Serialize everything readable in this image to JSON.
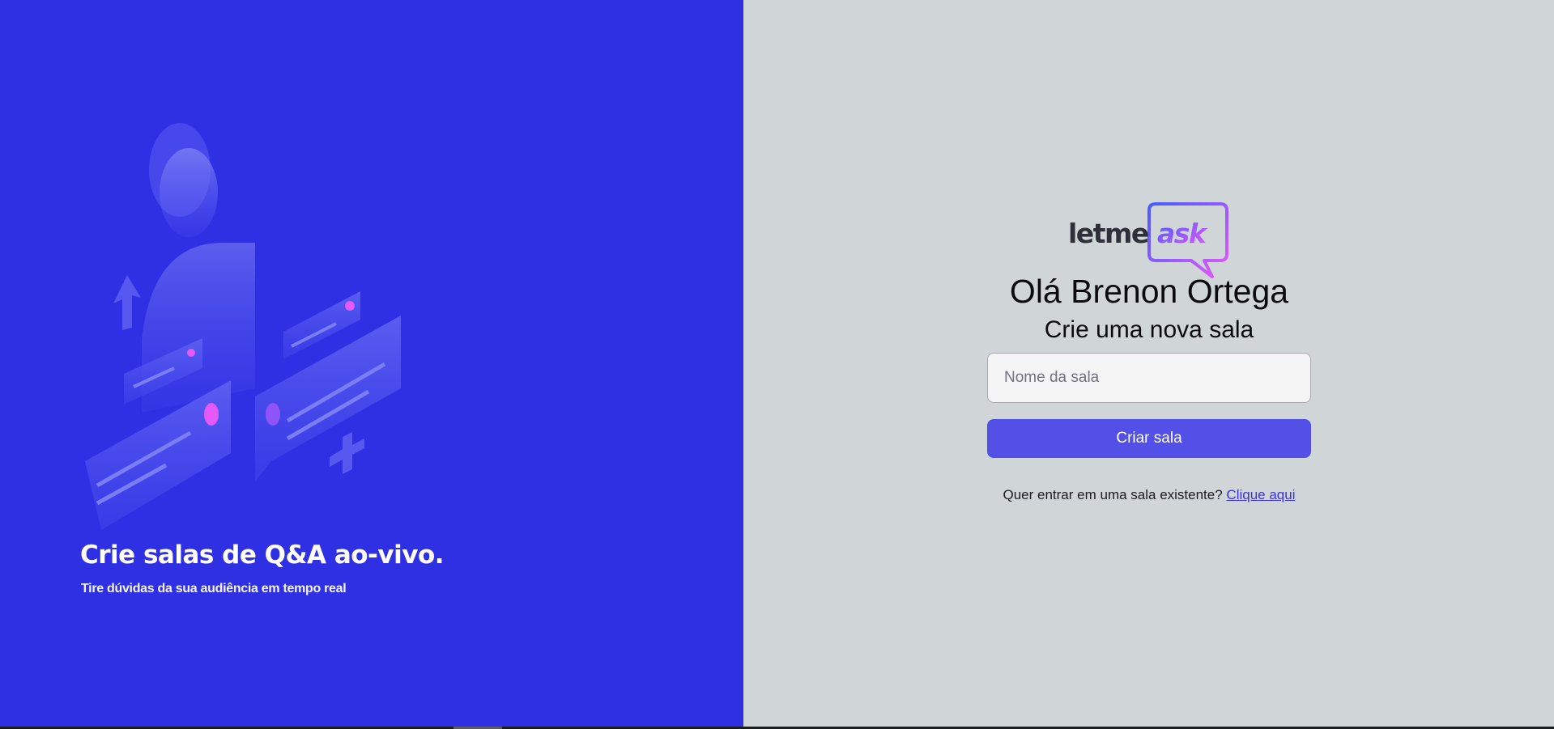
{
  "aside": {
    "title": "Crie salas de Q&A ao-vivo.",
    "subtitle": "Tire dúvidas da sua audiência em tempo real",
    "illustration_icon": "illustration-icon"
  },
  "logo": {
    "text_plain": "letme",
    "text_accent": "ask",
    "icon": "speech-bubble-icon"
  },
  "main": {
    "greeting": "Olá Brenon Ortega",
    "subtitle": "Crie uma nova sala",
    "room_input": {
      "placeholder": "Nome da sala",
      "value": ""
    },
    "create_button_label": "Criar sala",
    "join_prompt": "Quer entrar em uma sala existente?",
    "join_link": "Clique aqui"
  },
  "colors": {
    "aside_bg": "#2f30e3",
    "main_bg": "#d0d5d8",
    "button_bg": "#5250e6",
    "link": "#3b34d8",
    "logo_gradient_start": "#485bff",
    "logo_gradient_end": "#e559f9"
  }
}
